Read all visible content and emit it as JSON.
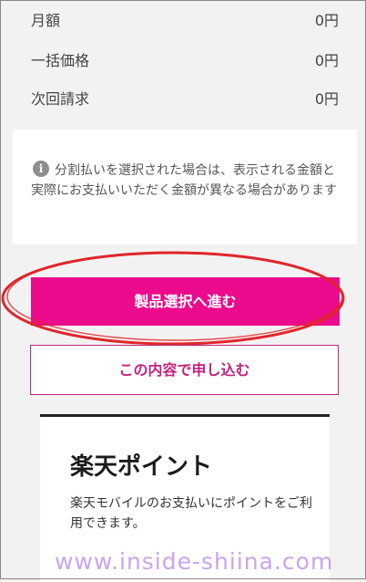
{
  "prices": [
    {
      "label": "月額",
      "value": "0円"
    },
    {
      "label": "一括価格",
      "value": "0円"
    },
    {
      "label": "次回請求",
      "value": "0円"
    }
  ],
  "notice": {
    "icon": "info-icon",
    "icon_glyph": "i",
    "text": "分割払いを選択された場合は、表示される金額と実際にお支払いいただく金額が異なる場合があります"
  },
  "buttons": {
    "proceed_label": "製品選択へ進む",
    "apply_label": "この内容で申し込む"
  },
  "points": {
    "title": "楽天ポイント",
    "description": "楽天モバイルのお支払いにポイントをご利用できます。"
  },
  "watermark": "www.inside-shiina.com",
  "colors": {
    "primary": "#eb0b8c",
    "secondary_border": "#c0237d",
    "annotation": "#e0262b"
  }
}
